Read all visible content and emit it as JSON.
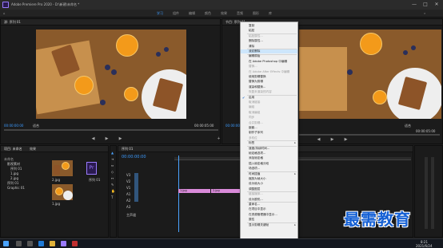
{
  "window": {
    "title": "Adobe Premiere Pro 2020 - D:\\新建\\未命名 *",
    "controls": [
      "—",
      "□",
      "✕"
    ]
  },
  "workspaces": [
    "学习",
    "组件",
    "编辑",
    "颜色",
    "效果",
    "音频",
    "图形",
    "库"
  ],
  "source_monitor": {
    "label": "源: 序列 01",
    "timecode_left": "00:00:00:00",
    "fit": "适合",
    "timecode_right": "00:00:05:00"
  },
  "program_monitor": {
    "label": "节目: 序列 01",
    "timecode_left": "00:00:00:00",
    "fit": "适合",
    "timecode_right": "00:00:05:00"
  },
  "project_panel": {
    "tabs": [
      "项目: 未命名",
      "效果"
    ],
    "tree": [
      "未命名",
      "影视素材",
      "序列 01",
      "1.jpg",
      "2.jpg",
      "序列 01",
      "Graphic 01"
    ],
    "items": [
      "2.jpg",
      "序列 01",
      "1.jpg"
    ]
  },
  "timeline": {
    "tab": "序列 01",
    "timecode": "00:00:00:00",
    "tracks": [
      "V3",
      "V2",
      "V1",
      "A1",
      "A2",
      "A3",
      "主声道"
    ],
    "clips": [
      "1.jpg",
      "2.jpg",
      "1.jpg"
    ]
  },
  "context_menu": {
    "items": [
      {
        "label": "复制",
        "state": "normal"
      },
      {
        "label": "粘贴",
        "state": "normal"
      },
      {
        "label": "粘贴属性...",
        "state": "disabled"
      },
      {
        "label": "删除属性...",
        "state": "normal"
      },
      {
        "label": "清除",
        "state": "normal"
      },
      {
        "label": "波纹删除",
        "state": "highlight"
      },
      {
        "label": "编辑原始",
        "state": "normal"
      },
      {
        "label": "在 Adobe Photoshop 中编辑",
        "state": "normal"
      },
      {
        "label": "替换...",
        "state": "disabled"
      },
      {
        "label": "在 Adobe After Effects 中编辑",
        "state": "disabled"
      },
      {
        "label": "使用剪辑替换",
        "state": "normal"
      },
      {
        "label": "替换为剪辑",
        "state": "normal"
      },
      {
        "label": "渲染和替换...",
        "state": "normal"
      },
      {
        "label": "恢复未渲染的内容",
        "state": "disabled"
      },
      {
        "label": "启用",
        "state": "checked"
      },
      {
        "label": "取消链接",
        "state": "disabled"
      },
      {
        "label": "编组",
        "state": "disabled"
      },
      {
        "label": "取消编组",
        "state": "disabled"
      },
      {
        "label": "同步",
        "state": "disabled"
      },
      {
        "label": "合并剪辑...",
        "state": "disabled"
      },
      {
        "label": "嵌套...",
        "state": "normal"
      },
      {
        "label": "制作子序列",
        "state": "normal"
      },
      {
        "label": "多机位",
        "state": "disabled"
      },
      {
        "label": "标签",
        "state": "submenu"
      },
      {
        "label": "速度/持续时间...",
        "state": "normal"
      },
      {
        "label": "帧定格选项...",
        "state": "normal"
      },
      {
        "label": "添加帧定格",
        "state": "normal"
      },
      {
        "label": "插入帧定格分段",
        "state": "normal"
      },
      {
        "label": "场选项...",
        "state": "normal"
      },
      {
        "label": "时间插值",
        "state": "submenu"
      },
      {
        "label": "缩放为帧大小",
        "state": "normal"
      },
      {
        "label": "设为帧大小",
        "state": "normal"
      },
      {
        "label": "调整图层",
        "state": "normal"
      },
      {
        "label": "链接媒体...",
        "state": "disabled"
      },
      {
        "label": "设为脱机...",
        "state": "normal"
      },
      {
        "label": "重命名...",
        "state": "normal"
      },
      {
        "label": "在项目中显示",
        "state": "normal"
      },
      {
        "label": "在资源管理器中显示...",
        "state": "normal"
      },
      {
        "label": "属性",
        "state": "normal"
      },
      {
        "label": "显示剪辑关键帧",
        "state": "submenu"
      }
    ]
  },
  "taskbar": {
    "time": "8:21",
    "date": "2021/6/24"
  },
  "watermark": "最需教育"
}
